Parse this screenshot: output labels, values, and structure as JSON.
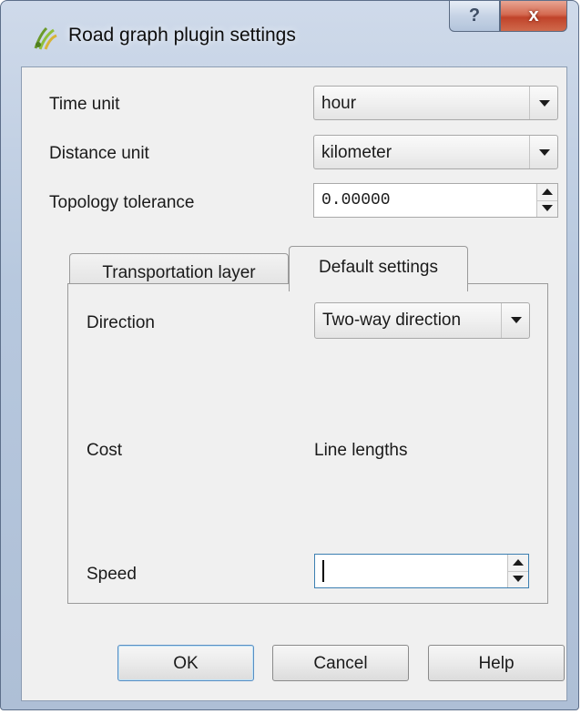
{
  "window": {
    "title": "Road graph plugin settings",
    "help_glyph": "?",
    "close_glyph": "x"
  },
  "fields": {
    "time_unit": {
      "label": "Time unit",
      "value": "hour"
    },
    "distance_unit": {
      "label": "Distance unit",
      "value": "kilometer"
    },
    "topology_tolerance": {
      "label": "Topology tolerance",
      "value": "0.00000"
    }
  },
  "tabs": [
    {
      "label": "Transportation layer",
      "active": false
    },
    {
      "label": "Default settings",
      "active": true
    }
  ],
  "default_settings": {
    "direction": {
      "label": "Direction",
      "value": "Two-way direction"
    },
    "cost": {
      "label": "Cost",
      "value": "Line lengths"
    },
    "speed": {
      "label": "Speed",
      "value": ""
    }
  },
  "buttons": {
    "ok": "OK",
    "cancel": "Cancel",
    "help": "Help"
  }
}
